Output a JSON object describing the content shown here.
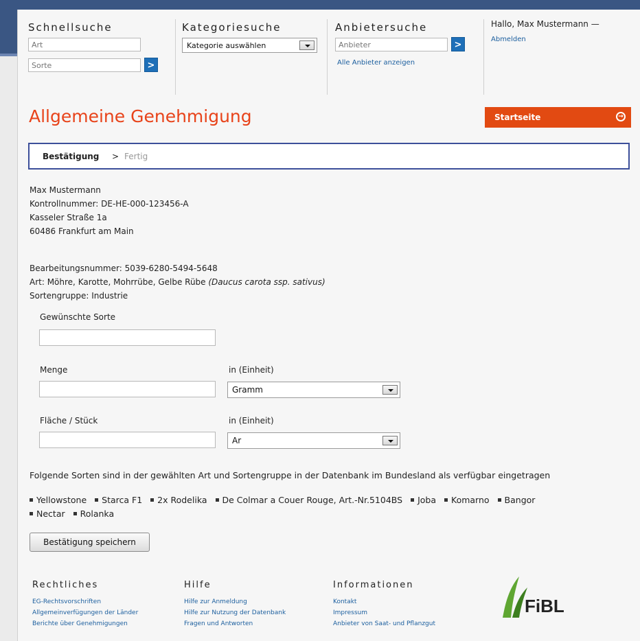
{
  "header": {
    "quick_search": {
      "title": "Schnellsuche",
      "art_placeholder": "Art",
      "sorte_placeholder": "Sorte",
      "go_label": ">"
    },
    "category_search": {
      "title": "Kategoriesuche",
      "select_value": "Kategorie auswählen"
    },
    "supplier_search": {
      "title": "Anbietersuche",
      "placeholder": "Anbieter",
      "go_label": ">",
      "all_link": "Alle Anbieter anzeigen"
    },
    "user": {
      "greeting": "Hallo, Max Mustermann —",
      "logout": "Abmelden"
    }
  },
  "page": {
    "title": "Allgemeine Genehmigung",
    "home_button": "Startseite",
    "steps": {
      "current": "Bestätigung",
      "separator": ">",
      "next": "Fertig"
    }
  },
  "address": {
    "name": "Max Mustermann",
    "control_number": "Kontrollnummer: DE-HE-000-123456-A",
    "street": "Kasseler Straße 1a",
    "city": "60486 Frankfurt am Main"
  },
  "details": {
    "processing_number": "Bearbeitungsnummer: 5039-6280-5494-5648",
    "art_prefix": "Art: Möhre, Karotte, Mohrrübe, Gelbe Rübe ",
    "art_latin": "(Daucus carota ssp. sativus)",
    "variety_group": "Sortengruppe: Industrie"
  },
  "form": {
    "desired_variety_label": "Gewünschte Sorte",
    "desired_variety_value": "",
    "quantity_label": "Menge",
    "quantity_value": "",
    "quantity_unit_label": "in (Einheit)",
    "quantity_unit_value": "Gramm",
    "area_label": "Fläche / Stück",
    "area_value": "",
    "area_unit_label": "in (Einheit)",
    "area_unit_value": "Ar"
  },
  "available": {
    "intro": "Folgende Sorten sind in der gewählten Art und Sortengruppe in der Datenbank im Bundesland als verfügbar eingetragen",
    "row1": [
      "Yellowstone",
      "Starca F1",
      "2x Rodelika",
      "De Colmar a Couer Rouge, Art.-Nr.5104BS",
      "Joba",
      "Komarno",
      "Bangor"
    ],
    "row2": [
      "Nectar",
      "Rolanka"
    ]
  },
  "save_button": "Bestätigung speichern",
  "footer": {
    "legal": {
      "title": "Rechtliches",
      "links": [
        "EG-Rechtsvorschriften",
        "Allgemeinverfügungen der Länder",
        "Berichte über Genehmigungen"
      ]
    },
    "help": {
      "title": "Hilfe",
      "links": [
        "Hilfe zur Anmeldung",
        "Hilfe zur Nutzung der Datenbank",
        "Fragen und Antworten"
      ]
    },
    "info": {
      "title": "Informationen",
      "links": [
        "Kontakt",
        "Impressum",
        "Anbieter von Saat- und Pflanzgut"
      ]
    },
    "logo_text": "FiBL"
  },
  "colors": {
    "accent_orange": "#e8431a",
    "home_button": "#e24a12",
    "link_blue": "#1b5e9e",
    "go_button": "#1e6fb8",
    "step_border": "#3c4f9a",
    "logo_green": "#5fa632"
  }
}
